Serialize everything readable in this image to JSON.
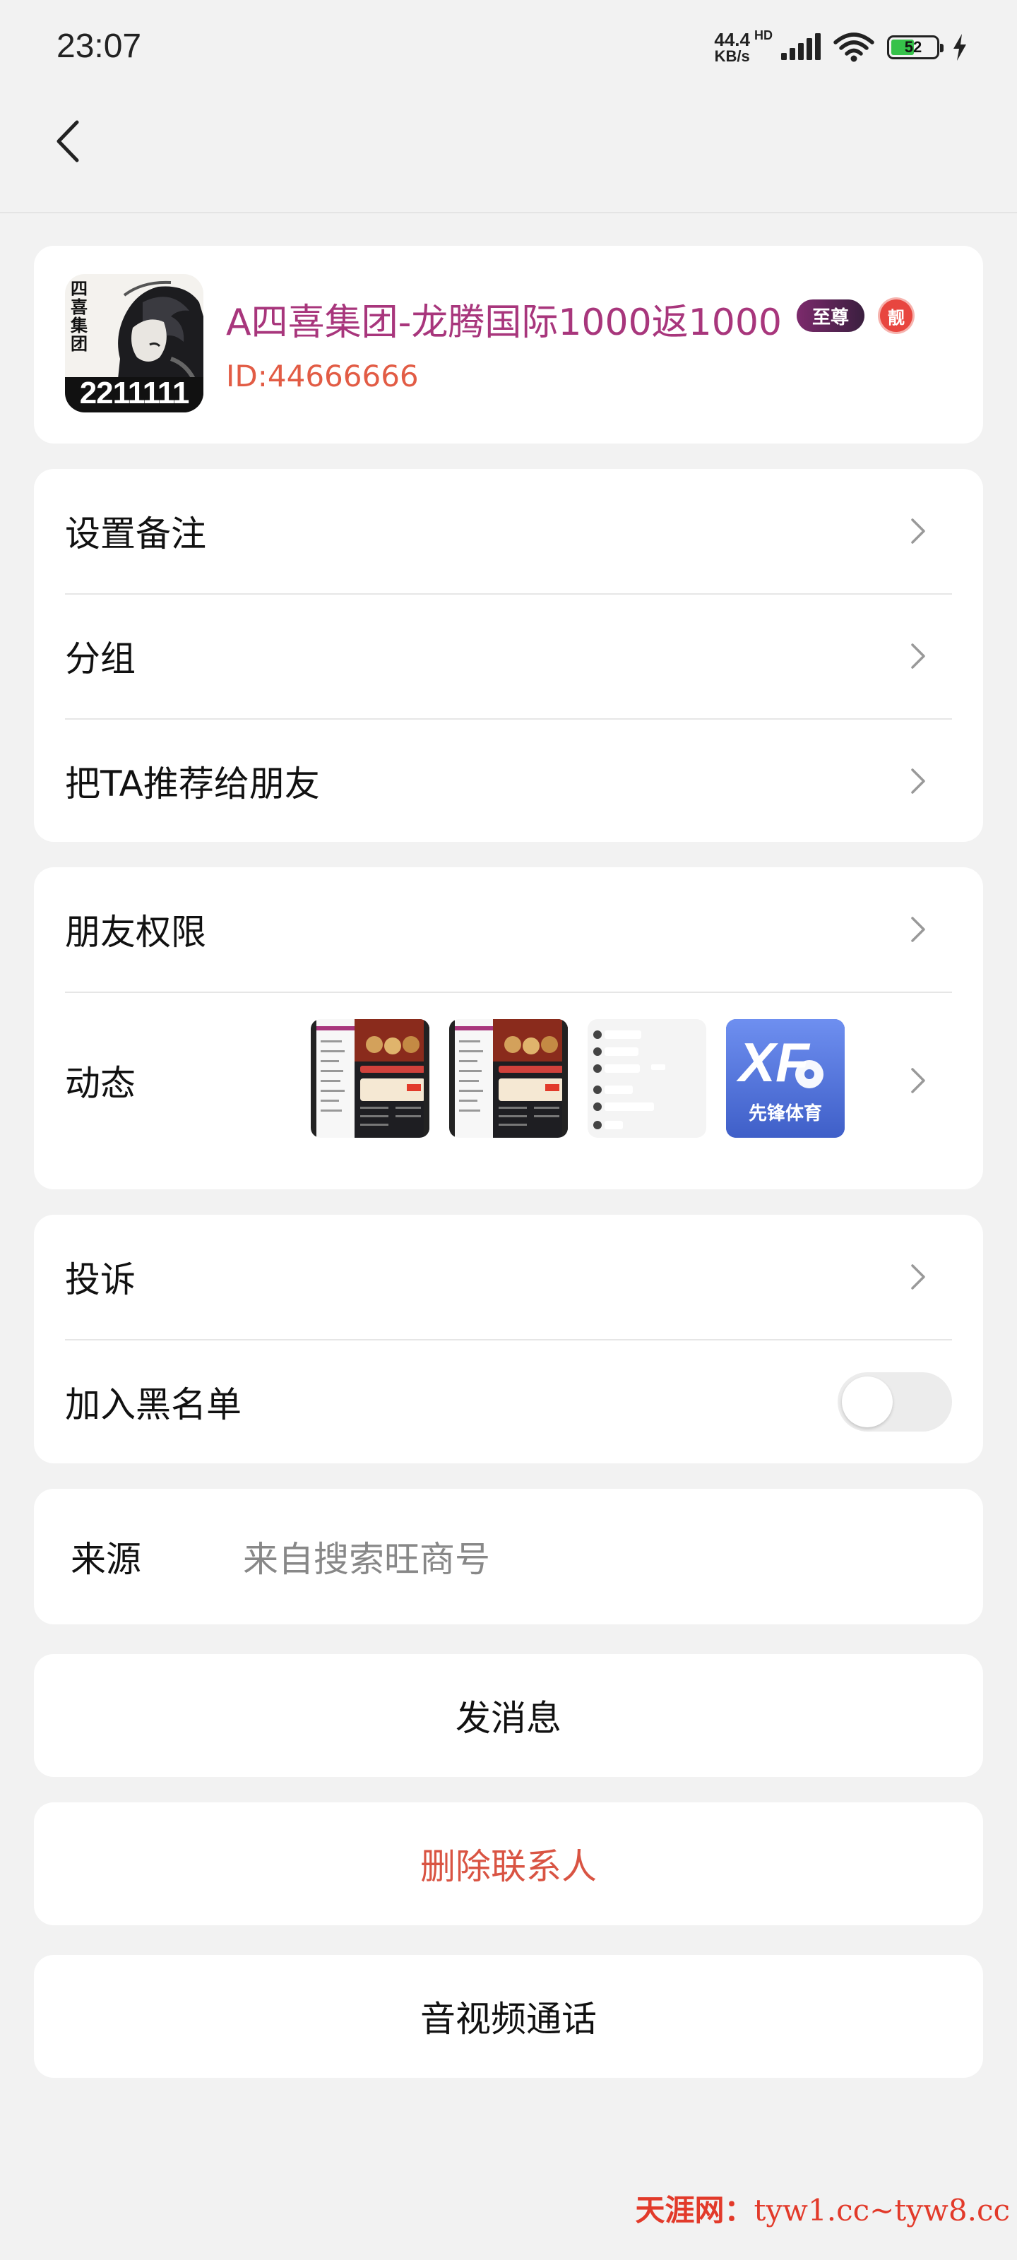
{
  "status_bar": {
    "time": "23:07",
    "net_speed_value": "44.4",
    "net_speed_unit": "KB/s",
    "hd": "HD",
    "battery": "52",
    "battery_level": 0.52,
    "icons": [
      "signal-icon",
      "wifi-icon",
      "battery-icon",
      "charging-icon"
    ]
  },
  "header": {
    "back_icon": "chevron-left-icon"
  },
  "profile": {
    "avatar_text_vertical": "四喜集团",
    "avatar_number": "2211111",
    "name": "A四喜集团-龙腾国际1000返1000",
    "badge_rank": "至尊",
    "badge_pretty": "靓",
    "id": "ID:44666666",
    "name_color": "#a8367c",
    "id_color": "#e25c45"
  },
  "settings_group": {
    "items": [
      {
        "label": "设置备注"
      },
      {
        "label": "分组"
      },
      {
        "label": "把TA推荐给朋友"
      }
    ]
  },
  "privacy_group": {
    "permission_label": "朋友权限",
    "moments_label": "动态",
    "thumbnails": [
      {
        "kind": "app-screenshot"
      },
      {
        "kind": "app-screenshot"
      },
      {
        "kind": "chat-screenshot"
      },
      {
        "kind": "logo",
        "logo_text": "XF",
        "logo_caption": "先锋体育"
      }
    ]
  },
  "safety_group": {
    "report_label": "投诉",
    "blacklist_label": "加入黑名单",
    "blacklist_enabled": false
  },
  "source": {
    "label": "来源",
    "value": "来自搜索旺商号"
  },
  "actions": {
    "send_message": "发消息",
    "delete_contact": "删除联系人",
    "av_call": "音视频通话",
    "danger_color": "#d95443"
  },
  "watermark": {
    "brand": "天涯网：",
    "url": "tyw1.cc~tyw8.cc"
  }
}
